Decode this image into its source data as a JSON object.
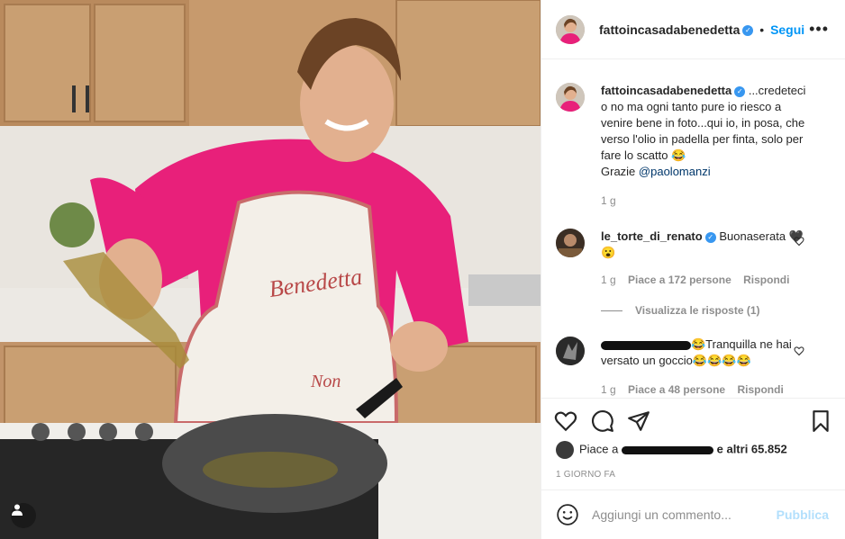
{
  "post": {
    "username": "fattoincasadabenedetta",
    "follow_label": "Segui",
    "separator": "•",
    "caption": "...credeteci o no ma ogni tanto pure io riesco a venire bene in foto...qui io, in posa, che verso l'olio in padella per finta, solo per fare lo scatto 😂",
    "thanks_prefix": "Grazie",
    "mention": "@paolomanzi",
    "caption_age": "1 g",
    "apron_text": "Benedetta",
    "apron_text2": "Non"
  },
  "comments": [
    {
      "username": "le_torte_di_renato",
      "verified": true,
      "text": "Buonaserata 🖤😮",
      "age": "1 g",
      "likes": "Piace a 172 persone",
      "reply": "Rispondi",
      "view_replies": "Visualizza le risposte (1)"
    },
    {
      "username": "",
      "verified": false,
      "text": "😂Tranquilla ne hai versato un goccio😂😂😂😂",
      "age": "1 g",
      "likes": "Piace a 48 persone",
      "reply": "Rispondi"
    }
  ],
  "actions": {
    "icons": [
      "heart-icon",
      "comment-icon",
      "share-icon",
      "bookmark-icon"
    ],
    "likes_prefix": "Piace a",
    "likes_suffix": "e altri 65.852",
    "date": "1 GIORNO FA"
  },
  "add_comment": {
    "placeholder": "Aggiungi un commento...",
    "publish_label": "Pubblica"
  },
  "colors": {
    "accent": "#0095f6",
    "verified": "#3897f0",
    "publish_disabled": "#b2dffc",
    "shirt": "#e8207a"
  }
}
